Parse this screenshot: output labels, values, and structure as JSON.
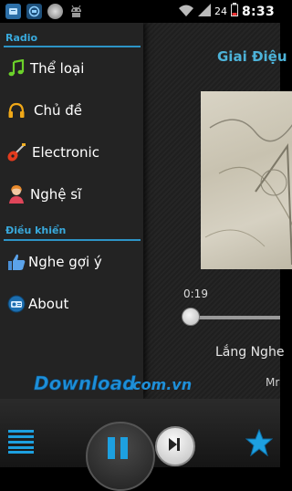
{
  "status_bar": {
    "time": "8:33",
    "battery": "24",
    "left_icons": [
      "notification-icon",
      "app-icon",
      "media-icon",
      "android-icon"
    ],
    "right_icons": [
      "wifi-icon",
      "signal-icon",
      "battery-icon"
    ]
  },
  "drawer": {
    "sections": [
      {
        "header": "Radio",
        "items": [
          {
            "label": "Thể loại",
            "icon": "music-note-icon"
          },
          {
            "label": "Chủ đề",
            "icon": "headphones-icon"
          },
          {
            "label": "Electronic",
            "icon": "guitar-icon"
          },
          {
            "label": "Nghệ sĩ",
            "icon": "artist-icon"
          }
        ]
      },
      {
        "header": "Điều khiển",
        "items": [
          {
            "label": "Nghe gợi ý",
            "icon": "thumbs-up-icon"
          },
          {
            "label": "About",
            "icon": "radio-icon"
          }
        ]
      }
    ]
  },
  "main": {
    "title": "Giai Điệu",
    "elapsed": "0:19",
    "song_title": "Lắng Nghe",
    "song_artist": "Mr",
    "page_dots": [
      "#1b8fc8",
      "#9e9e9e",
      "#6fa82f",
      "#d98e1a",
      "#3d7fb5",
      "#c41f1f"
    ]
  },
  "watermark": "Download.com.vn",
  "controls": {
    "menu_icon": "menu-icon",
    "play_pause_icon": "pause-icon",
    "next_icon": "next-icon",
    "favorite_icon": "star-icon"
  },
  "colors": {
    "accent": "#39a9dc",
    "divider": "#2d94c6"
  }
}
